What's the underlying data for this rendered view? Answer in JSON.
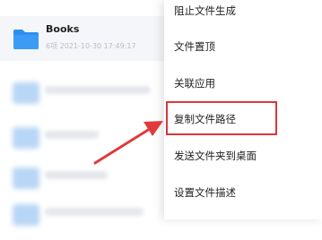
{
  "file_list": {
    "selected_item": {
      "name": "Books",
      "meta": "6项  2021-10-30 17:49:17"
    }
  },
  "context_menu": {
    "items": [
      "阻止文件生成",
      "文件置顶",
      "关联应用",
      "复制文件路径",
      "发送文件夹到桌面",
      "设置文件描述"
    ],
    "highlighted_index": 3
  },
  "colors": {
    "folder": "#2e8ff0",
    "highlight": "#d9383a",
    "selected_row": "#f4f6f9"
  },
  "icons": {
    "folder": "folder-icon",
    "annotation": "annotation-arrow"
  }
}
